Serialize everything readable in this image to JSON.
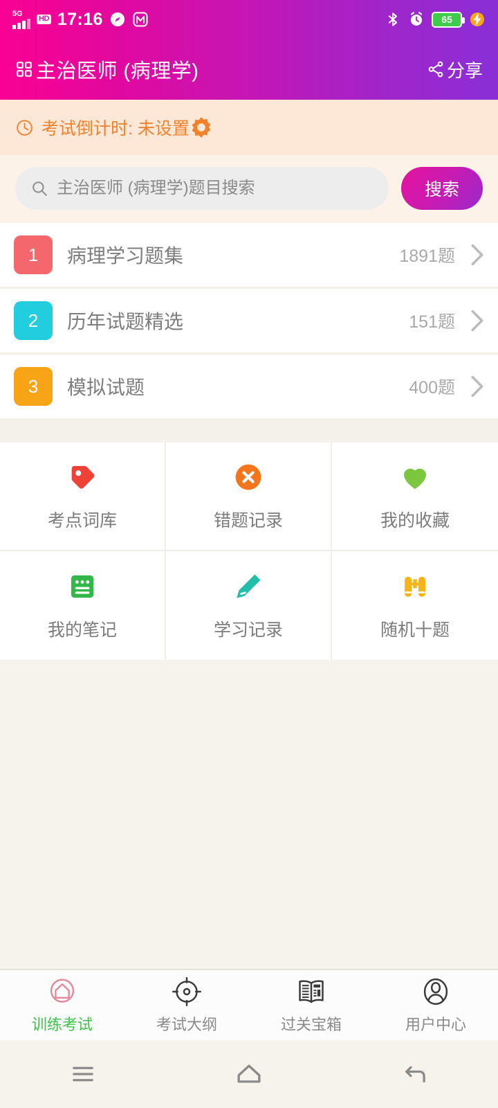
{
  "status_bar": {
    "network_label": "5G",
    "hd_label": "HD",
    "time": "17:16",
    "compass_icon": "compass-icon",
    "app_icon": "m-app-icon",
    "bluetooth_icon": "bluetooth-icon",
    "alarm_icon": "alarm-icon",
    "battery_percent": "65",
    "charging_icon": "charging-bolt-icon",
    "battery_color": "#3FCB4B"
  },
  "header": {
    "grid_icon": "apps-grid-icon",
    "title": "主治医师 (病理学)",
    "share_icon": "share-icon",
    "share_label": "分享",
    "gradient_from": "#FA0193",
    "gradient_to": "#8A2FD6"
  },
  "countdown": {
    "clock_icon": "clock-icon",
    "text": "考试倒计时: 未设置",
    "settings_icon": "gear-icon",
    "accent_color": "#F0822C",
    "background": "#FDE8D7"
  },
  "search": {
    "icon": "magnifier-icon",
    "placeholder": "主治医师 (病理学)题目搜索",
    "value": "",
    "button_label": "搜索"
  },
  "list": {
    "rows": [
      {
        "badge": "1",
        "badge_color": "#F4676C",
        "title": "病理学习题集",
        "count": "1891题",
        "chevron": "chevron-right-icon"
      },
      {
        "badge": "2",
        "badge_color": "#22CEDE",
        "title": "历年试题精选",
        "count": "151题",
        "chevron": "chevron-right-icon"
      },
      {
        "badge": "3",
        "badge_color": "#F7A416",
        "title": "模拟试题",
        "count": "400题",
        "chevron": "chevron-right-icon"
      }
    ]
  },
  "grid": {
    "cells": [
      {
        "icon": "tag-icon",
        "label": "考点词库",
        "color": "#EE4237"
      },
      {
        "icon": "error-circle-x-icon",
        "label": "错题记录",
        "color": "#F4761C"
      },
      {
        "icon": "heart-icon",
        "label": "我的收藏",
        "color": "#7DC63F"
      },
      {
        "icon": "note-icon",
        "label": "我的笔记",
        "color": "#34B749"
      },
      {
        "icon": "pencil-icon",
        "label": "学习记录",
        "color": "#1FBDAC"
      },
      {
        "icon": "binoculars-icon",
        "label": "随机十题",
        "color": "#F8B414"
      }
    ]
  },
  "tabbar": {
    "active_color": "#3FC34B",
    "tabs": [
      {
        "icon": "home-circle-icon",
        "label": "训练考试",
        "active": true
      },
      {
        "icon": "target-icon",
        "label": "考试大纲",
        "active": false
      },
      {
        "icon": "open-book-icon",
        "label": "过关宝箱",
        "active": false
      },
      {
        "icon": "user-circle-icon",
        "label": "用户中心",
        "active": false
      }
    ]
  },
  "android_nav": {
    "buttons": [
      {
        "icon": "menu-recent-icon",
        "label": "recent-apps"
      },
      {
        "icon": "home-icon",
        "label": "home"
      },
      {
        "icon": "back-icon",
        "label": "back"
      }
    ]
  }
}
